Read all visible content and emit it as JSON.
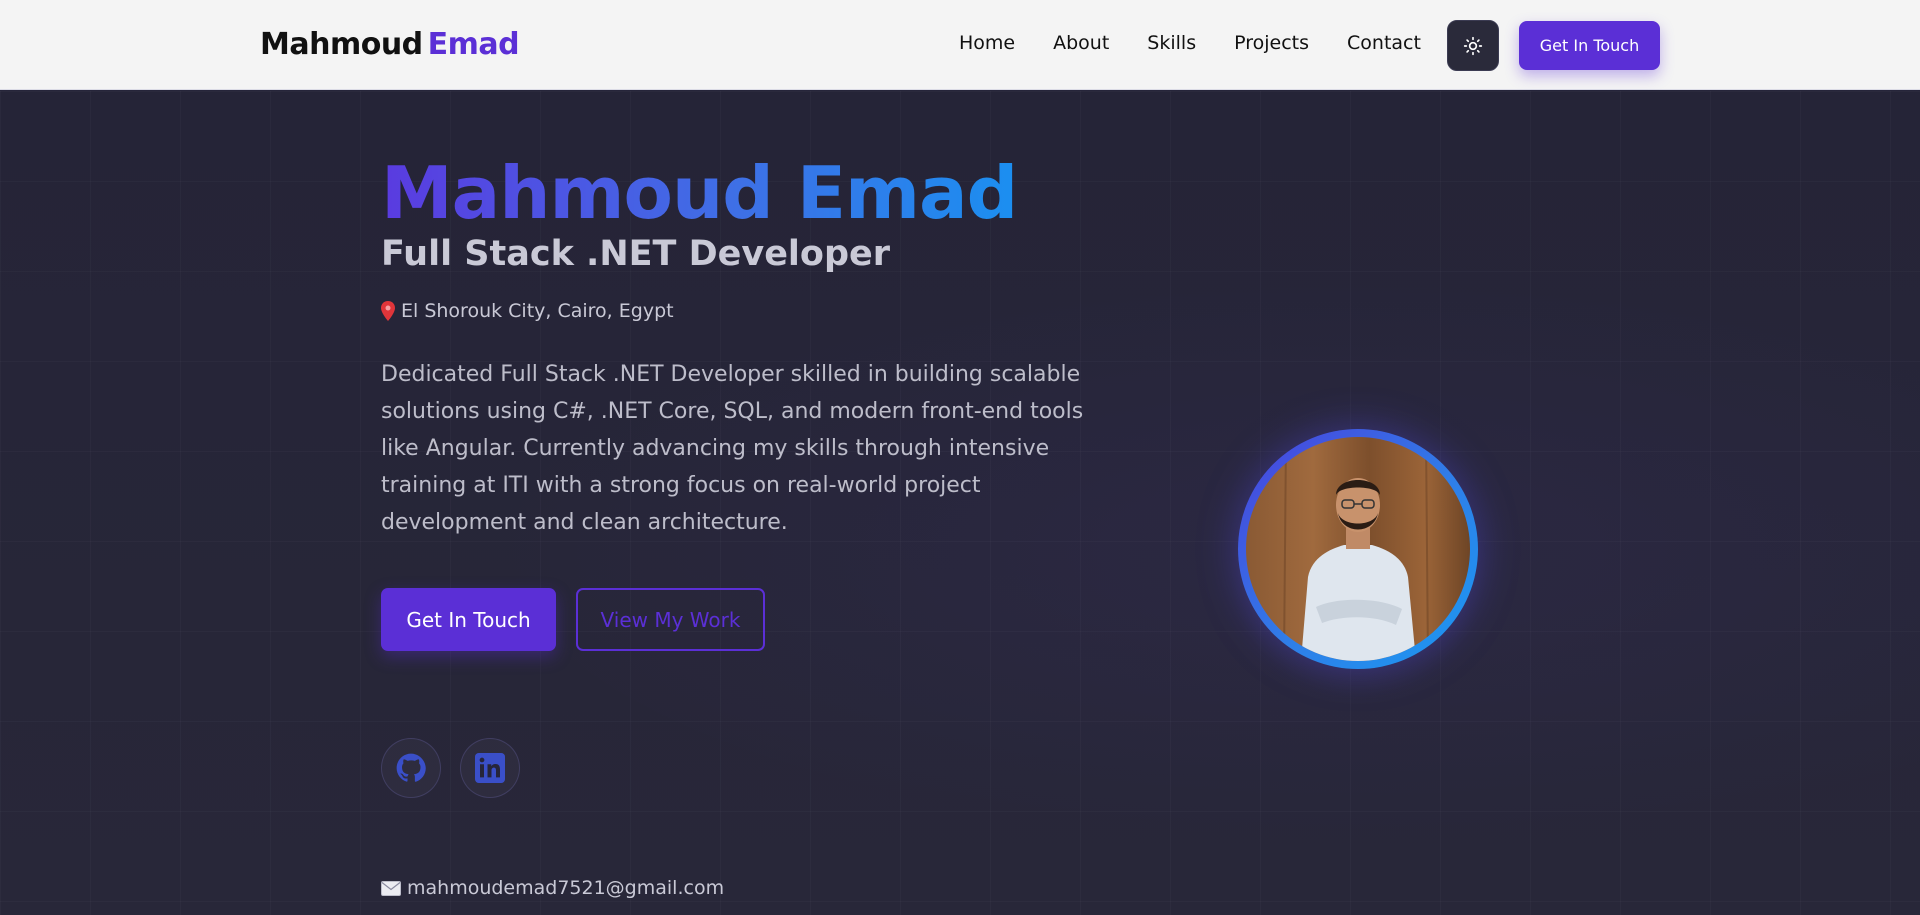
{
  "nav": {
    "brand_first": "Mahmoud",
    "brand_last": "Emad",
    "links": [
      "Home",
      "About",
      "Skills",
      "Projects",
      "Contact"
    ],
    "theme_toggle_icon": "sun-icon",
    "cta_label": "Get In Touch"
  },
  "hero": {
    "name": "Mahmoud Emad",
    "title": "Full Stack .NET Developer",
    "location": "El Shorouk City, Cairo, Egypt",
    "description": "Dedicated Full Stack .NET Developer skilled in building scalable solutions using C#, .NET Core, SQL, and modern front-end tools like Angular. Currently advancing my skills through intensive training at ITI with a strong focus on real-world project development and clean architecture.",
    "primary_button": "Get In Touch",
    "secondary_button": "View My Work",
    "socials": [
      "github-icon",
      "linkedin-icon"
    ],
    "email": "mahmoudemad7521@gmail.com"
  },
  "colors": {
    "accent": "#5b2fd6",
    "gradient_start": "#5a3be0",
    "gradient_end": "#1b8ff0",
    "background": "#26253a",
    "navbar": "#f4f4f4"
  }
}
